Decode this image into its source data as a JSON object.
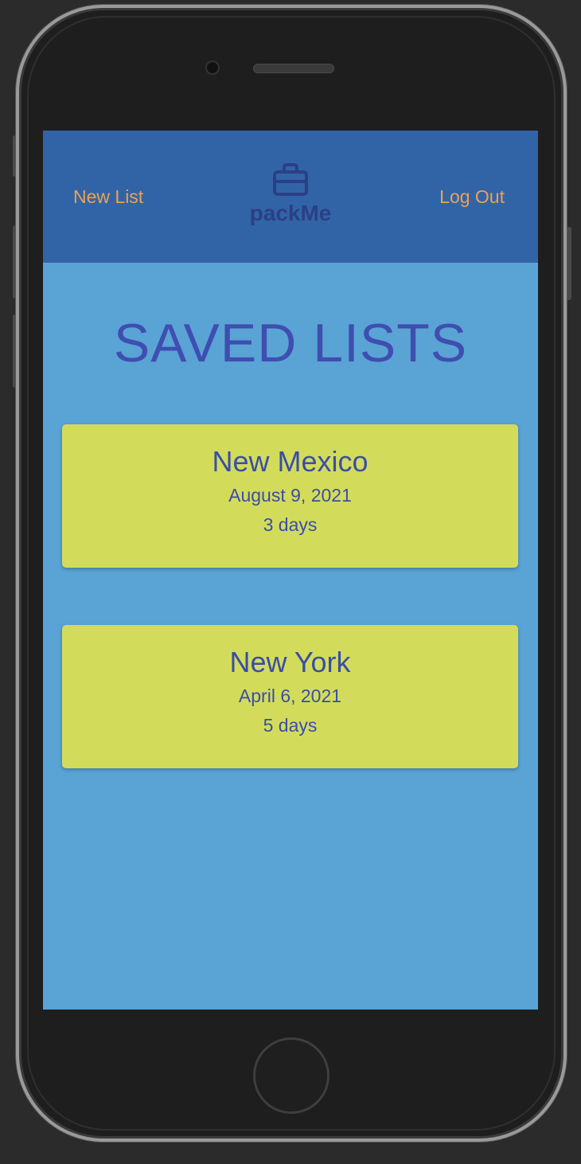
{
  "nav": {
    "new_list_label": "New List",
    "brand_name": "packMe",
    "brand_icon": "briefcase-icon",
    "logout_label": "Log Out"
  },
  "page": {
    "title": "SAVED LISTS"
  },
  "saved_lists": [
    {
      "name": "New Mexico",
      "date": "August 9, 2021",
      "duration": "3 days"
    },
    {
      "name": "New York",
      "date": "April 6, 2021",
      "duration": "5 days"
    }
  ],
  "colors": {
    "navbar": "#3164a6",
    "background": "#59a3d5",
    "nav_link": "#eca151",
    "brand": "#2b3f86",
    "title": "#3f4eb0",
    "card": "#d3dc5a",
    "card_text": "#3a4ea6"
  }
}
